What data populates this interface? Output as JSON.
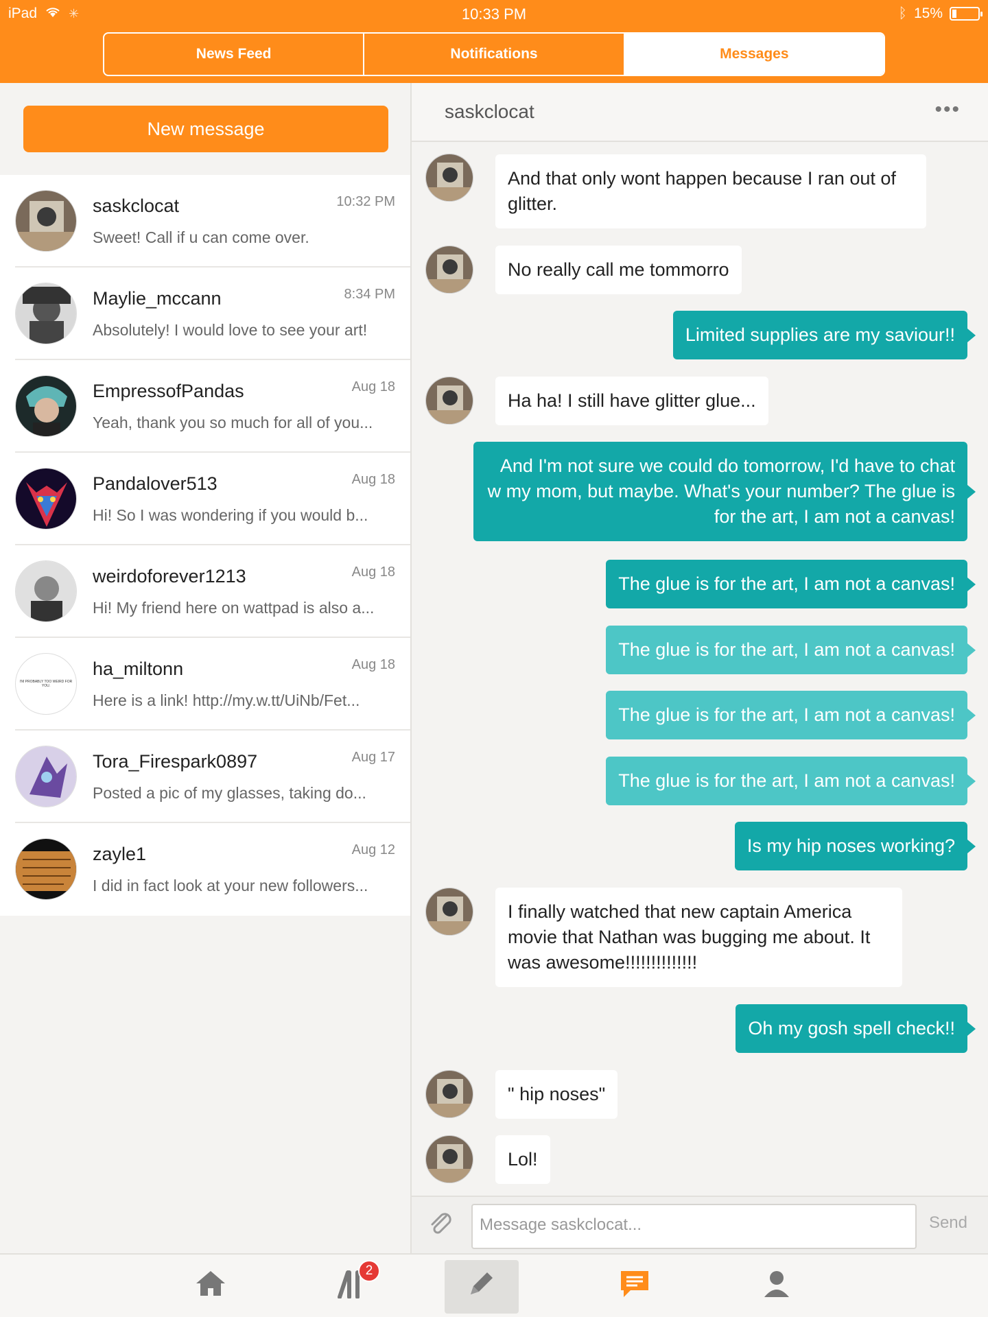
{
  "status": {
    "device": "iPad",
    "time": "10:33 PM",
    "battery": "15%"
  },
  "tabs": [
    "News Feed",
    "Notifications",
    "Messages"
  ],
  "left": {
    "new_message": "New message",
    "conversations": [
      {
        "name": "saskclocat",
        "time": "10:32 PM",
        "preview": "Sweet! Call if u can come over."
      },
      {
        "name": "Maylie_mccann",
        "time": "8:34 PM",
        "preview": "Absolutely! I would love to see your art!"
      },
      {
        "name": "EmpressofPandas",
        "time": "Aug 18",
        "preview": "Yeah, thank you so much for all of you..."
      },
      {
        "name": "Pandalover513",
        "time": "Aug 18",
        "preview": "Hi! So I was wondering if you would b..."
      },
      {
        "name": "weirdoforever1213",
        "time": "Aug 18",
        "preview": "Hi! My friend here on wattpad is also a..."
      },
      {
        "name": "ha_miltonn",
        "time": "Aug 18",
        "preview": "Here is a link! http://my.w.tt/UiNb/Fet..."
      },
      {
        "name": "Tora_Firespark0897",
        "time": "Aug 17",
        "preview": "Posted a pic of my glasses, taking do..."
      },
      {
        "name": "zayle1",
        "time": "Aug 12",
        "preview": "I did in fact look at your new followers..."
      }
    ],
    "avatar_text_ha_miltonn": "I'M PROBABLY TOO WEIRD FOR YOU."
  },
  "chat": {
    "title": "saskclocat",
    "more_icon": "•••",
    "messages": [
      {
        "dir": "in",
        "text": "And that only wont happen because I ran out of glitter."
      },
      {
        "dir": "in",
        "text": "No really call me tommorro"
      },
      {
        "dir": "out",
        "text": "Limited supplies are my saviour!!"
      },
      {
        "dir": "in",
        "text": "Ha ha! I still have glitter glue..."
      },
      {
        "dir": "out",
        "text": "And I'm not sure we could do tomorrow, I'd have to chat w my mom, but maybe. What's your number? The glue is for the art, I am not a canvas!"
      },
      {
        "dir": "out",
        "text": "The glue is for the art, I am not a canvas!"
      },
      {
        "dir": "out",
        "text": "The glue is for the art, I am not a canvas!"
      },
      {
        "dir": "out",
        "text": "The glue is for the art, I am not a canvas!"
      },
      {
        "dir": "out",
        "text": "The glue is for the art, I am not a canvas!"
      },
      {
        "dir": "out",
        "text": "Is my hip noses working?"
      },
      {
        "dir": "in",
        "text": "I finally watched that new captain America movie that Nathan was bugging me about. It was awesome!!!!!!!!!!!!!!"
      },
      {
        "dir": "out",
        "text": "Oh my gosh spell check!!"
      },
      {
        "dir": "in",
        "text": "\" hip noses\""
      },
      {
        "dir": "in",
        "text": "Lol!"
      }
    ],
    "placeholder": "Message saskclocat...",
    "send": "Send"
  },
  "tabbar": {
    "library_badge": "2"
  },
  "colors": {
    "brand": "#ff8c1a",
    "outgoing": "#13a8a8",
    "outgoing_faded": "#4dc6c6"
  }
}
